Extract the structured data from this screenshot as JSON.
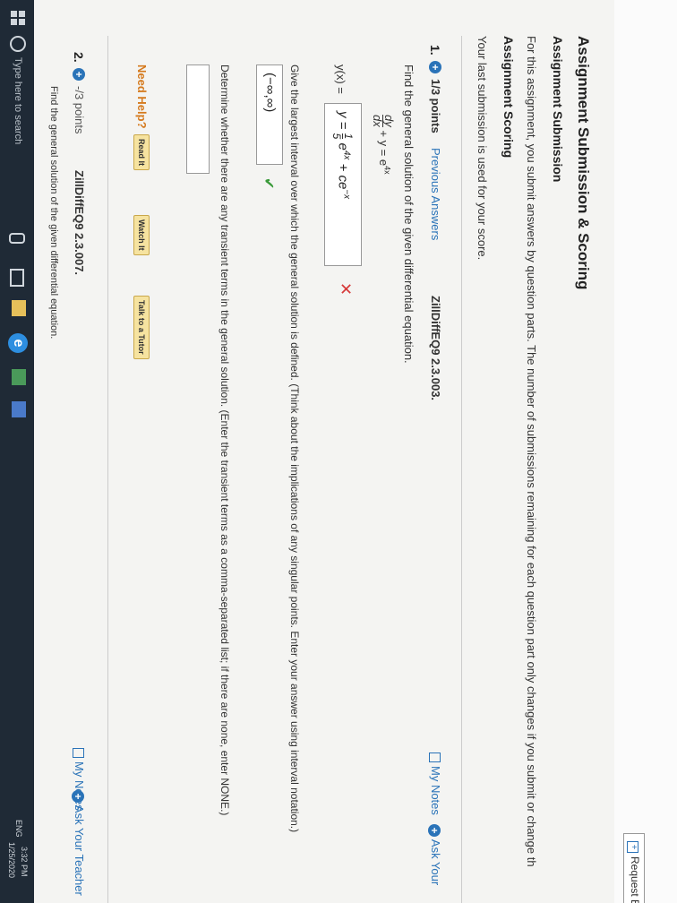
{
  "header": {
    "request_button": "Request E"
  },
  "section": {
    "title": "Assignment Submission & Scoring",
    "subtitle": "Assignment Submission",
    "description": "For this assignment, you submit answers by question parts. The number of submissions remaining for each question part only changes if you submit or change th",
    "scoring_title": "Assignment Scoring",
    "scoring_text": "Your last submission is used for your score."
  },
  "q1": {
    "number": "1.",
    "points": "1/3 points",
    "previous_answers": "Previous Answers",
    "code": "ZillDiffEQ9 2.3.003.",
    "my_notes": "My Notes",
    "ask_teacher": "Ask Your",
    "prompt": "Find the general solution of the given differential equation.",
    "eq_num": "dy",
    "eq_den": "dx",
    "eq_rest": "+ y = e",
    "eq_exp": "4x",
    "answer_label": "y(x) =",
    "answer_value": "y = 1/5 e^4x + ce^−x",
    "answer_pre": "y =",
    "answer_frac_top": "1",
    "answer_frac_bot": "5",
    "answer_e": "e",
    "answer_e_exp": "4x",
    "answer_mid": "+ ce",
    "answer_mid_exp": "−x",
    "wrong_mark": "✕",
    "interval_prompt": "Give the largest interval over which the general solution is defined. (Think about the implications of any singular points. Enter your answer using interval notation.)",
    "interval_value": "(−∞,∞)",
    "correct_mark": "✔",
    "transient_prompt": "Determine whether there are any transient terms in the general solution. (Enter the transient terms as a comma-separated list; if there are none, enter NONE.)",
    "need_help": "Need Help?",
    "read_it": "Read It",
    "watch_it": "Watch It",
    "talk_tutor": "Talk to a Tutor"
  },
  "q2": {
    "number": "2.",
    "points": "-/3 points",
    "code": "ZillDiffEQ9 2.3.007.",
    "my_notes": "My Notes",
    "ask_teacher": "Ask Your Teacher",
    "prompt": "Find the general solution of the given differential equation."
  },
  "taskbar": {
    "search_placeholder": "Type here to search",
    "lang": "ENG",
    "time": "3:32 PM",
    "date": "1/25/2020"
  }
}
